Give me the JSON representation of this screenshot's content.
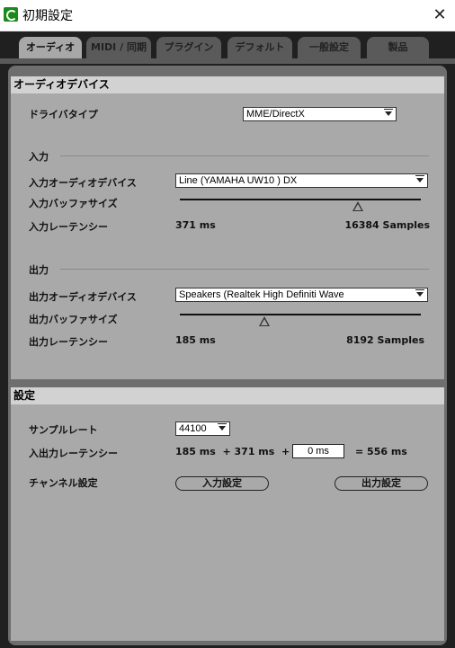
{
  "window": {
    "title": "初期設定",
    "close_glyph": "✕",
    "icon": "app-logo-icon"
  },
  "tabs": [
    {
      "label": "オーディオ",
      "active": true
    },
    {
      "label": "MIDI / 同期",
      "active": false
    },
    {
      "label": "プラグイン",
      "active": false
    },
    {
      "label": "デフォルト",
      "active": false
    },
    {
      "label": "一般設定",
      "active": false
    },
    {
      "label": "製品",
      "active": false
    }
  ],
  "audio_device": {
    "heading": "オーディオデバイス",
    "driver_type_label": "ドライバタイプ",
    "driver_type_value": "MME/DirectX",
    "input": {
      "heading": "入力",
      "device_label": "入力オーディオデバイス",
      "device_value": "Line (YAMAHA UW10 ) DX",
      "buffer_label": "入力バッファサイズ",
      "buffer_level": 0.74,
      "latency_label": "入力レーテンシー",
      "latency_ms": "371 ms",
      "samples": "16384 Samples"
    },
    "output": {
      "heading": "出力",
      "device_label": "出力オーディオデバイス",
      "device_value": "Speakers (Realtek High Definiti Wave",
      "buffer_label": "出力バッファサイズ",
      "buffer_level": 0.35,
      "latency_label": "出力レーテンシー",
      "latency_ms": "185 ms",
      "samples": "8192 Samples"
    }
  },
  "settings": {
    "heading": "設定",
    "sample_rate_label": "サンプルレート",
    "sample_rate_value": "44100",
    "io_latency_label": "入出力レーテンシー",
    "io_latency_part1": "185 ms  + 371 ms  +",
    "io_latency_offset": "0 ms",
    "io_latency_total": "= 556 ms",
    "channel_label": "チャンネル設定",
    "input_config_button": "入力設定",
    "output_config_button": "出力設定"
  }
}
